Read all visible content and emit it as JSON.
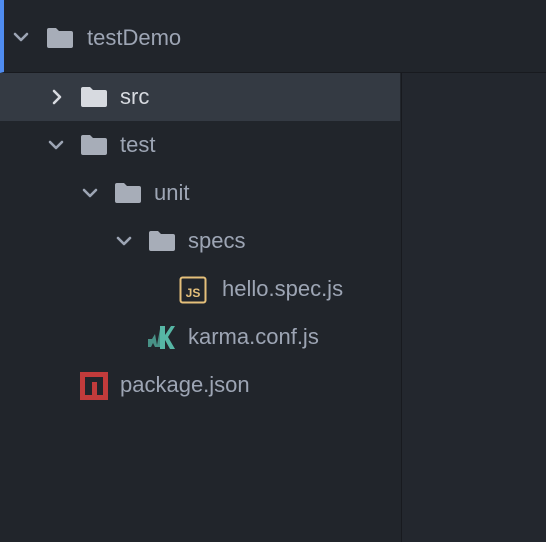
{
  "tree": {
    "root": {
      "label": "testDemo",
      "icon": "folder-icon",
      "expanded": true
    },
    "items": [
      {
        "label": "src",
        "icon": "folder-icon",
        "expanded": false,
        "selected": true,
        "depth": 1
      },
      {
        "label": "test",
        "icon": "folder-icon",
        "expanded": true,
        "depth": 1
      },
      {
        "label": "unit",
        "icon": "folder-icon",
        "expanded": true,
        "depth": 2
      },
      {
        "label": "specs",
        "icon": "folder-icon",
        "expanded": true,
        "depth": 3
      },
      {
        "label": "hello.spec.js",
        "icon": "js-file-icon",
        "depth": 4
      },
      {
        "label": "karma.conf.js",
        "icon": "karma-icon",
        "depth": 3
      },
      {
        "label": "package.json",
        "icon": "npm-icon",
        "depth": 1
      }
    ]
  },
  "colors": {
    "background": "#21252b",
    "selection": "#343a43",
    "accent": "#4f8cf0",
    "text": "#9da5b4",
    "text_bright": "#d7dae0",
    "folder": "#a7adb8",
    "js_icon": "#e5c07b",
    "karma_icon": "#56b6a5",
    "npm_icon": "#c23b3b"
  }
}
